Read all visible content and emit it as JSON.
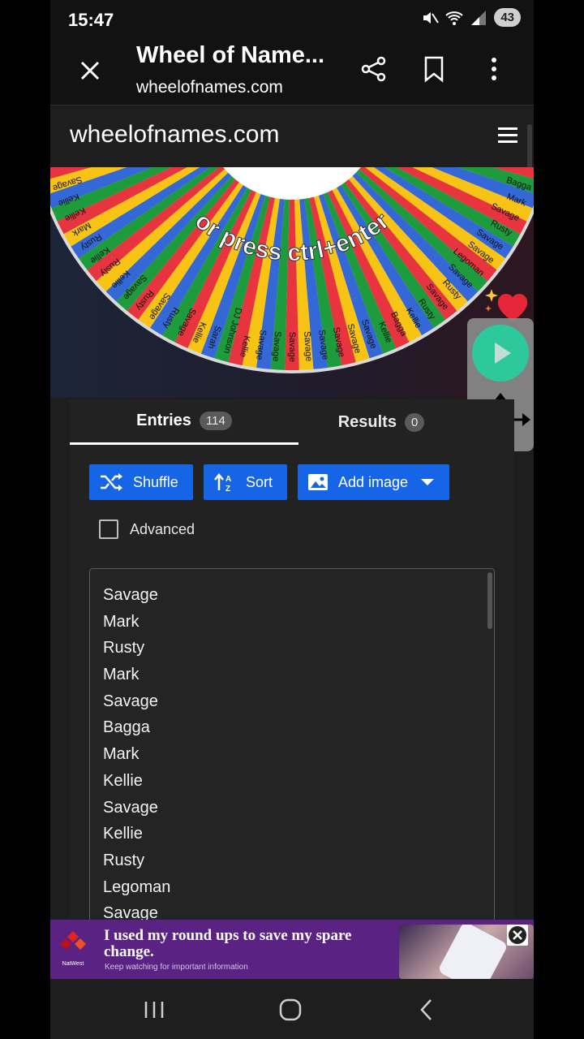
{
  "status_bar": {
    "time": "15:47",
    "battery": "43"
  },
  "tab_header": {
    "title": "Wheel of Name...",
    "url": "wheelofnames.com"
  },
  "site": {
    "logo": "wheelofnames.com"
  },
  "wheel": {
    "prompt": "or press ctrl+enter",
    "slice_colors": [
      "#e7343f",
      "#1e9b3c",
      "#3468d7",
      "#f7c315"
    ],
    "visible_labels": [
      "Bagga",
      "Mark",
      "Savage",
      "Rusty",
      "Savage",
      "Savage",
      "Legoman",
      "Savage",
      "Rusty",
      "Savage",
      "Rusty",
      "Kellie",
      "Bagga",
      "Kellie",
      "Savage",
      "Savage",
      "Savage",
      "Savage",
      "Savage",
      "Savage",
      "Savage",
      "Savage",
      "Kellie",
      "DJ Johnson",
      "Sarah",
      "Kellie",
      "Savage",
      "Rusty",
      "Savage",
      "Rusty",
      "Savage",
      "Kellie",
      "Rusty",
      "Kellie",
      "Rusty",
      "Mark",
      "Kellie",
      "Kellie",
      "Savage"
    ]
  },
  "tabs": {
    "entries_label": "Entries",
    "entries_count": "114",
    "results_label": "Results",
    "results_count": "0"
  },
  "toolbar": {
    "shuffle_label": "Shuffle",
    "sort_label": "Sort",
    "add_image_label": "Add image"
  },
  "advanced": {
    "label": "Advanced",
    "checked": false
  },
  "entries": [
    "Savage",
    "Mark",
    "Rusty",
    "Mark",
    "Savage",
    "Bagga",
    "Mark",
    "Kellie",
    "Savage",
    "Kellie",
    "Rusty",
    "Legoman",
    "Savage"
  ],
  "ad": {
    "brand": "NatWest",
    "headline": "I used my round ups to save my spare change.",
    "subline": "Keep watching for important information"
  },
  "colors": {
    "accent_button": "#1565e6",
    "play_button": "#2fd8a8",
    "ad_background": "#5a2282"
  }
}
